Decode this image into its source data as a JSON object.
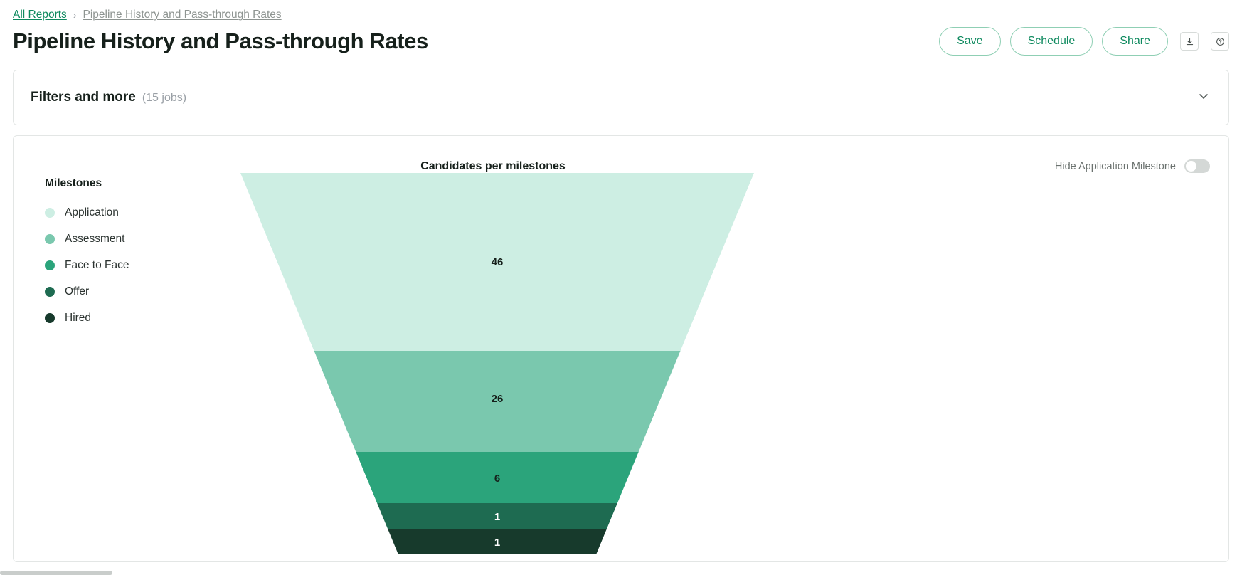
{
  "breadcrumb": {
    "root_label": "All Reports",
    "separator": "›",
    "current_label": "Pipeline History and Pass-through Rates"
  },
  "header": {
    "title": "Pipeline History and Pass-through Rates",
    "buttons": {
      "save": "Save",
      "schedule": "Schedule",
      "share": "Share"
    },
    "icons": {
      "download": "download-icon",
      "help": "help-circle-icon"
    }
  },
  "filters": {
    "title": "Filters and more",
    "count": "(15 jobs)",
    "expand_icon": "chevron-down-icon"
  },
  "chart_panel": {
    "title": "Candidates per milestones",
    "toggle_label": "Hide Application Milestone",
    "toggle_state": "off",
    "legend_title": "Milestones"
  },
  "colors": {
    "accent_green": "#0f8a5f",
    "band_application": "#cdeee3",
    "band_assessment": "#7ac8ae",
    "band_face_to_face": "#2ba47b",
    "band_offer": "#1e6b51",
    "band_hired": "#173a2c",
    "toggle_off": "#d4d8d6"
  },
  "chart_data": {
    "type": "funnel",
    "title": "Candidates per milestones",
    "xlabel": "",
    "ylabel": "",
    "legend_position": "left",
    "grid": false,
    "categories": [
      "Application",
      "Assessment",
      "Face to Face",
      "Offer",
      "Hired"
    ],
    "values": [
      46,
      26,
      6,
      1,
      1
    ],
    "value_labels": [
      "46",
      "26",
      "6",
      "1",
      "1"
    ],
    "series": [
      {
        "name": "Milestones",
        "points": [
          {
            "label": "Application",
            "value": 46,
            "color": "#cdeee3"
          },
          {
            "label": "Assessment",
            "value": 26,
            "color": "#7ac8ae"
          },
          {
            "label": "Face to Face",
            "value": 6,
            "color": "#2ba47b"
          },
          {
            "label": "Offer",
            "value": 1,
            "color": "#1e6b51"
          },
          {
            "label": "Hired",
            "value": 1,
            "color": "#173a2c"
          }
        ]
      }
    ]
  }
}
